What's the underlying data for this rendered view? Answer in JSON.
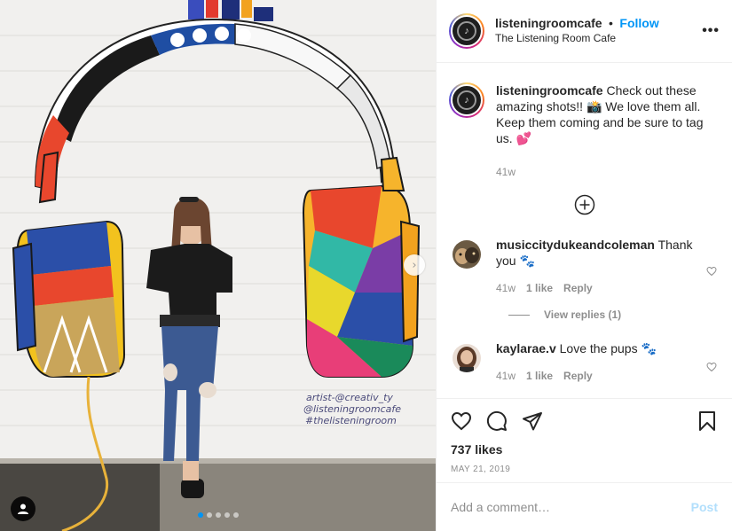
{
  "post": {
    "image_alt": "Woman standing in front of colorful headphones mural",
    "mural_signature": [
      "artist-@creativ_ty",
      "@listeningroomcafe",
      "#thelisteningroom"
    ],
    "carousel_count": 5,
    "carousel_active": 1
  },
  "header": {
    "username": "listeningroomcafe",
    "separator": "•",
    "follow_label": "Follow",
    "subtitle": "The Listening Room Cafe",
    "more_label": "•••"
  },
  "caption": {
    "username": "listeningroomcafe",
    "text": "Check out these amazing shots!! 📸 We love them all. Keep them coming and be sure to tag us. 💕",
    "age": "41w"
  },
  "comments": [
    {
      "username": "musiccitydukeandcoleman",
      "text": "Thank you 🐾",
      "age": "41w",
      "likes": "1 like",
      "reply": "Reply",
      "view_replies": "View replies (1)"
    },
    {
      "username": "kaylarae.v",
      "text": "Love the pups 🐾",
      "age": "41w",
      "likes": "1 like",
      "reply": "Reply"
    }
  ],
  "stats": {
    "likes": "737 likes",
    "date": "MAY 21, 2019"
  },
  "add_comment": {
    "placeholder": "Add a comment…",
    "post_label": "Post"
  },
  "colors": {
    "accent": "#0095f6",
    "post_disabled": "#b2dffc",
    "muted": "#8e8e8e"
  }
}
